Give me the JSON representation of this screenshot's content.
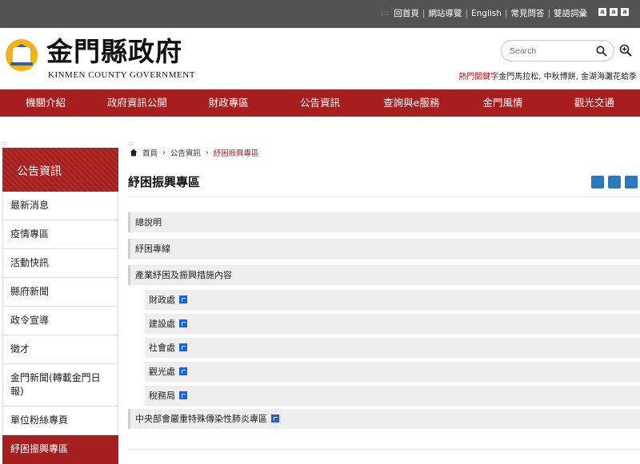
{
  "topbar": {
    "accesskey": ":::",
    "links": [
      "回首頁",
      "網站導覽",
      "English",
      "常見問答",
      "雙語詞彙"
    ],
    "font_sizes": [
      "a",
      "a",
      "a"
    ]
  },
  "header": {
    "logo_cn": "金門縣政府",
    "logo_en": "KINMEN COUNTY GOVERNMENT",
    "search_placeholder": "Search",
    "hot_label": "熱門關鍵字",
    "hot_keywords": "金門馬拉松, 中秋博餅, 金湖海灘花蛤季"
  },
  "nav": [
    "機關介紹",
    "政府資訊公開",
    "財政專區",
    "公告資訊",
    "查詢與e服務",
    "金門風情",
    "觀光交通"
  ],
  "sidebar": {
    "dots": ":::",
    "title": "公告資訊",
    "items": [
      "最新消息",
      "疫情專區",
      "活動快訊",
      "縣府新聞",
      "政令宣導",
      "徵才",
      "金門新聞(轉載金門日報)",
      "單位粉絲專頁",
      "紓困振興專區"
    ]
  },
  "breadcrumb": {
    "dots": ":::",
    "home": "首頁",
    "section": "公告資訊",
    "current": "紓困振興專區",
    "sep": "›"
  },
  "page": {
    "title": "紓困振興專區",
    "rows": [
      {
        "label": "總說明"
      },
      {
        "label": "紓困專線"
      },
      {
        "label": "產業紓困及振興措施內容"
      }
    ],
    "subrows": [
      "財政處",
      "建設處",
      "社會處",
      "觀光處",
      "稅務局"
    ],
    "last_row": "中央部會嚴重特殊傳染性肺炎專區"
  },
  "colors": {
    "brand_red": "#a61e1e",
    "topbar_gray": "#535353",
    "link_icon_blue": "#1a62d6"
  }
}
